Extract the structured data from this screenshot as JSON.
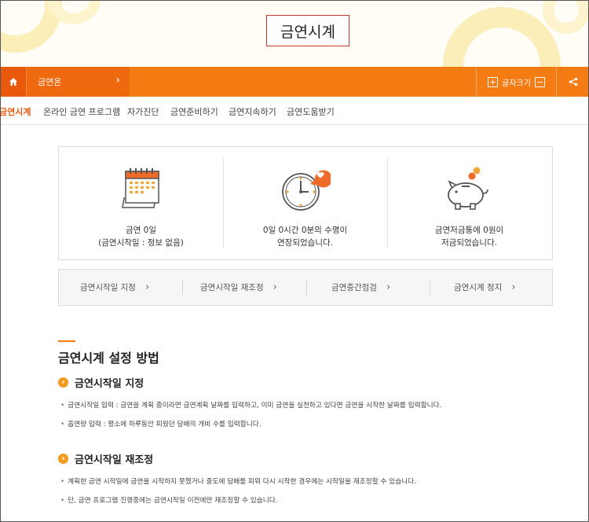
{
  "header": {
    "title": "금연시계"
  },
  "topbar": {
    "breadcrumb": "금연온",
    "font_size_label": "글자크기",
    "plus": "+",
    "minus": "−"
  },
  "tabs": [
    {
      "label": "금연시계",
      "active": true
    },
    {
      "label": "온라인 금연 프로그램",
      "active": false
    },
    {
      "label": "자가진단",
      "active": false
    },
    {
      "label": "금연준비하기",
      "active": false
    },
    {
      "label": "금연지속하기",
      "active": false
    },
    {
      "label": "금연도움받기",
      "active": false
    }
  ],
  "stats": [
    {
      "icon": "calendar-icon",
      "line1": "금연 0일",
      "line2": "(금연시작일 : 정보 없음)"
    },
    {
      "icon": "clock-heart-icon",
      "line1": "0일 0시간 0분의 수명이",
      "line2": "연장되었습니다."
    },
    {
      "icon": "piggy-bank-icon",
      "line1": "금연저금통에 0원이",
      "line2": "저금되었습니다."
    }
  ],
  "actions": [
    {
      "label": "금연시작일 지정"
    },
    {
      "label": "금연시작일 재조정"
    },
    {
      "label": "금연중간점검"
    },
    {
      "label": "금연시계 정지"
    }
  ],
  "guide": {
    "title": "금연시계 설정 방법",
    "sections": [
      {
        "heading": "금연시작일 지정",
        "bullets": [
          "금연시작일 입력 : 금연을 계획 중이라면 금연계획 날짜를 입력하고, 이미 금연을 실천하고 있다면 금연을 시작한 날짜를 입력합니다.",
          "흡연량 입력 : 평소에 하루동안 피웠던 담배의 개비 수를 입력합니다."
        ]
      },
      {
        "heading": "금연시작일 재조정",
        "bullets": [
          "계획한 금연 시작일에 금연을 시작하지 못했거나 중도에 담배를 피워 다시 시작한 경우에는 시작일을 재조정할 수 있습니다.",
          "단, 금연 프로그램 진행중에는 금연시작일 이전에만 재조정할 수 있습니다."
        ]
      }
    ]
  },
  "colors": {
    "accent": "#f47c12",
    "accent_dark": "#e8590c",
    "bullet_icon": "#f29c1f"
  }
}
